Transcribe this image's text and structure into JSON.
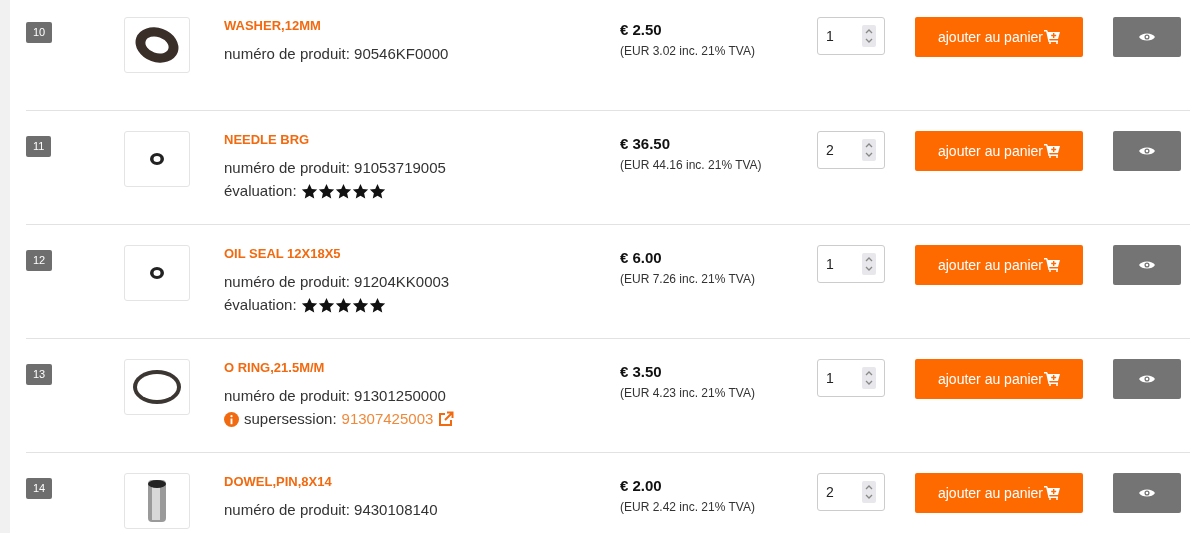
{
  "products": [
    {
      "index": "10",
      "name": "WASHER,12MM",
      "number_label": "numéro de produit:",
      "number": "90546KF0000",
      "price": "€ 2.50",
      "price_incl": "(EUR 3.02 inc. 21% TVA)",
      "quantity": "1",
      "cart_label": "ajouter au panier"
    },
    {
      "index": "11",
      "name": "NEEDLE BRG",
      "number_label": "numéro de produit:",
      "number": "91053719005",
      "rating_label": "évaluation:",
      "stars": 5,
      "price": "€ 36.50",
      "price_incl": "(EUR 44.16 inc. 21% TVA)",
      "quantity": "2",
      "cart_label": "ajouter au panier"
    },
    {
      "index": "12",
      "name": "OIL SEAL 12X18X5",
      "number_label": "numéro de produit:",
      "number": "91204KK0003",
      "rating_label": "évaluation:",
      "stars": 5,
      "price": "€ 6.00",
      "price_incl": "(EUR 7.26 inc. 21% TVA)",
      "quantity": "1",
      "cart_label": "ajouter au panier"
    },
    {
      "index": "13",
      "name": "O RING,21.5M/M",
      "number_label": "numéro de produit:",
      "number": "91301250000",
      "supersession_label": "supersession:",
      "supersession": "91307425003",
      "price": "€ 3.50",
      "price_incl": "(EUR 4.23 inc. 21% TVA)",
      "quantity": "1",
      "cart_label": "ajouter au panier"
    },
    {
      "index": "14",
      "name": "DOWEL,PIN,8X14",
      "number_label": "numéro de produit:",
      "number": "9430108140",
      "price": "€ 2.00",
      "price_incl": "(EUR 2.42 inc. 21% TVA)",
      "quantity": "2",
      "cart_label": "ajouter au panier"
    }
  ]
}
